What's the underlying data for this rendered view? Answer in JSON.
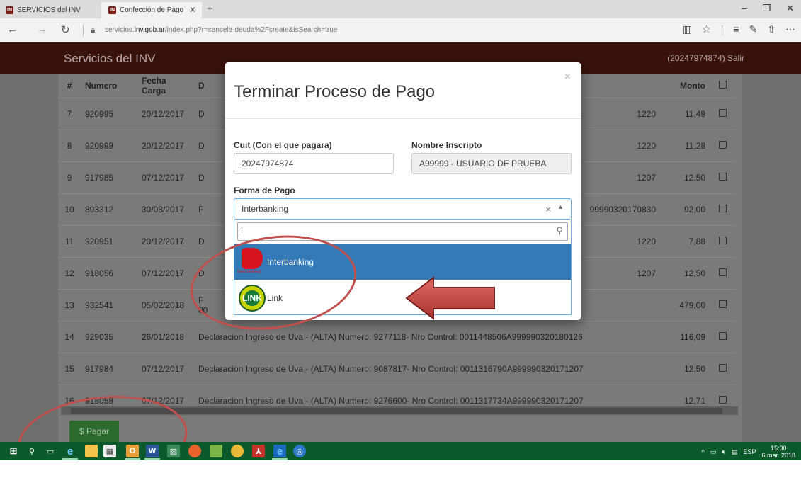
{
  "browser": {
    "tabs": [
      {
        "label": "SERVICIOS del INV",
        "active": false
      },
      {
        "label": "Confección de Pago",
        "active": true
      }
    ],
    "url_prefix": "servicios.",
    "url_domain": "inv.gob.ar",
    "url_path": "/index.php?r=cancela-deuda%2Fcreate&isSearch=true"
  },
  "app": {
    "brand": "Servicios del INV",
    "user": "(20247974874) Salir"
  },
  "table": {
    "headers": [
      "#",
      "Numero",
      "Fecha Carga",
      "D",
      "Monto"
    ],
    "rows": [
      {
        "idx": "7",
        "numero": "920995",
        "fecha": "20/12/2017",
        "desc": "D",
        "ctrl": "1220",
        "monto": "11,49"
      },
      {
        "idx": "8",
        "numero": "920998",
        "fecha": "20/12/2017",
        "desc": "D",
        "ctrl": "1220",
        "monto": "11,28"
      },
      {
        "idx": "9",
        "numero": "917985",
        "fecha": "07/12/2017",
        "desc": "D",
        "ctrl": "1207",
        "monto": "12,50"
      },
      {
        "idx": "10",
        "numero": "893312",
        "fecha": "30/08/2017",
        "desc": "F",
        "ctrl": "99990320170830",
        "monto": "92,00"
      },
      {
        "idx": "11",
        "numero": "920951",
        "fecha": "20/12/2017",
        "desc": "D",
        "ctrl": "1220",
        "monto": "7,88"
      },
      {
        "idx": "12",
        "numero": "918056",
        "fecha": "07/12/2017",
        "desc": "D",
        "ctrl": "1207",
        "monto": "12,50"
      },
      {
        "idx": "13",
        "numero": "932541",
        "fecha": "05/02/2018",
        "desc": "F\n00",
        "ctrl": "",
        "monto": "479,00"
      },
      {
        "idx": "14",
        "numero": "929035",
        "fecha": "26/01/2018",
        "desc": "Declaracion Ingreso de Uva - (ALTA) Numero: 9277118- Nro Control: 0011448506A999990320180126",
        "ctrl": "",
        "monto": "116,09"
      },
      {
        "idx": "15",
        "numero": "917984",
        "fecha": "07/12/2017",
        "desc": "Declaracion Ingreso de Uva - (ALTA) Numero: 9087817- Nro Control: 0011316790A999990320171207",
        "ctrl": "",
        "monto": "12,50"
      },
      {
        "idx": "16",
        "numero": "918058",
        "fecha": "07/12/2017",
        "desc": "Declaracion Ingreso de Uva - (ALTA) Numero: 9276600- Nro Control: 0011317734A999990320171207",
        "ctrl": "",
        "monto": "12,71"
      }
    ],
    "pay_button": "$ Pagar"
  },
  "modal": {
    "title": "Terminar Proceso de Pago",
    "close": "×",
    "cuit_label": "Cuit (Con el que pagara)",
    "cuit_value": "20247974874",
    "nombre_label": "Nombre Inscripto",
    "nombre_value": "A99999 - USUARIO DE PRUEBA",
    "forma_label": "Forma de Pago",
    "forma_selected": "Interbanking",
    "options": [
      {
        "label": "Interbanking",
        "logo": "interbanking-logo",
        "logo_text": "interbanking",
        "selected": true
      },
      {
        "label": "Link",
        "logo": "link-logo",
        "logo_text": "LINK",
        "selected": false
      }
    ]
  },
  "taskbar": {
    "lang": "ESP",
    "time": "15:30",
    "date": "6 mar. 2018"
  },
  "colors": {
    "navbar": "#3a120d",
    "selected_option": "#337ab7",
    "pay_button": "#2d6a2d",
    "annotation": "#c0504d",
    "taskbar": "#0c5a2c"
  }
}
